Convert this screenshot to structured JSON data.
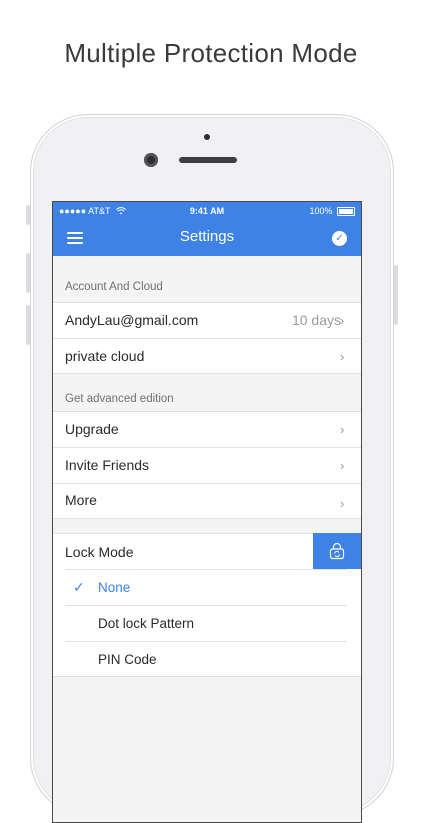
{
  "headline": "Multiple Protection Mode",
  "status_bar": {
    "carrier": "●●●●● AT&T",
    "time": "9:41 AM",
    "battery": "100%"
  },
  "nav": {
    "title": "Settings",
    "menu_icon": "hamburger-icon",
    "confirm_icon": "check-circle-icon"
  },
  "account": {
    "header": "Account And Cloud",
    "email": "AndyLau@gmail.com",
    "email_value": "10 days",
    "cloud": "private cloud"
  },
  "advanced": {
    "header": "Get advanced edition",
    "upgrade": "Upgrade",
    "invite": "Invite Friends",
    "more": "More"
  },
  "lock": {
    "label": "Lock Mode",
    "icon": "lock-refresh-icon",
    "options": [
      {
        "label": "None",
        "selected": true
      },
      {
        "label": "Dot lock Pattern",
        "selected": false
      },
      {
        "label": "PIN Code",
        "selected": false
      }
    ]
  },
  "colors": {
    "accent": "#3f82e6",
    "background": "#f4f4f4"
  }
}
